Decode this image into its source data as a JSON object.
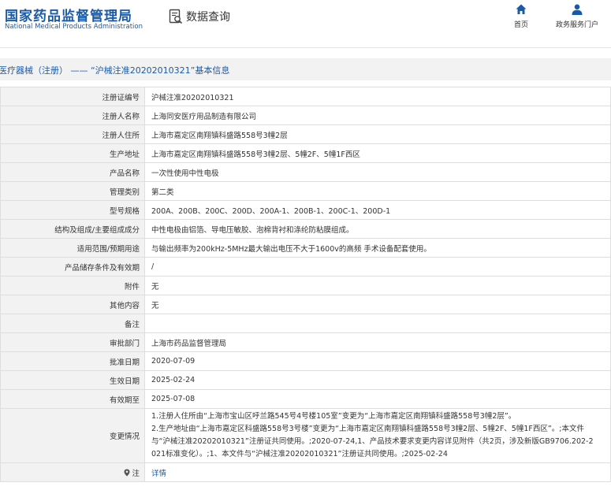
{
  "header": {
    "logo_cn": "国家药品监督管理局",
    "logo_en": "National Medical Products Administration",
    "query_label": "数据查询",
    "nav": [
      {
        "label": "首页",
        "icon": "home-icon"
      },
      {
        "label": "政务服务门户",
        "icon": "user-icon"
      }
    ]
  },
  "title": "医疗器械（注册） —— “沪械注准20202010321”基本信息",
  "rows": [
    {
      "label": "注册证编号",
      "value": "沪械注准20202010321"
    },
    {
      "label": "注册人名称",
      "value": "上海同安医疗用品制造有限公司"
    },
    {
      "label": "注册人住所",
      "value": "上海市嘉定区南翔镇科盛路558号3幢2层"
    },
    {
      "label": "生产地址",
      "value": "上海市嘉定区南翔镇科盛路558号3幢2层、5幢2F、5幢1F西区"
    },
    {
      "label": "产品名称",
      "value": "一次性使用中性电极"
    },
    {
      "label": "管理类别",
      "value": "第二类"
    },
    {
      "label": "型号规格",
      "value": "200A、200B、200C、200D、200A-1、200B-1、200C-1、200D-1"
    },
    {
      "label": "结构及组成/主要组成成分",
      "value": "中性电极由铝箔、导电压敏胶、泡棉背衬和涤纶防粘膜组成。"
    },
    {
      "label": "适用范围/预期用途",
      "value": "与输出频率为200kHz-5MHz最大输出电压不大于1600v的高频 手术设备配套使用。"
    },
    {
      "label": "产品储存条件及有效期",
      "value": "/"
    },
    {
      "label": "附件",
      "value": "无"
    },
    {
      "label": "其他内容",
      "value": "无"
    },
    {
      "label": "备注",
      "value": ""
    },
    {
      "label": "审批部门",
      "value": "上海市药品监督管理局"
    },
    {
      "label": "批准日期",
      "value": "2020-07-09"
    },
    {
      "label": "生效日期",
      "value": "2025-02-24"
    },
    {
      "label": "有效期至",
      "value": "2025-07-08"
    }
  ],
  "changes": {
    "label": "变更情况",
    "lines": [
      "1.注册人住所由“上海市宝山区呼兰路545号4号楼105室”变更为“上海市嘉定区南翔镇科盛路558号3幢2层”。",
      "2.生产地址由“上海市嘉定区科盛路558号3号楼”变更为“上海市嘉定区南翔镇科盛路558号3幢2层、5幢2F、5幢1F西区”。;本文件",
      "与“沪械注准20202010321”注册证共同使用。;2020-07-24,1、产品技术要求变更内容详见附件（共2页，涉及新版GB9706.202-2",
      "021标准变化）。;1、本文件与“沪械注准20202010321”注册证共同使用。;2025-02-24"
    ]
  },
  "note": {
    "label": "注",
    "link": "详情"
  },
  "colors": {
    "brand": "#1a5ba8",
    "label_bg": "#f2f2f2",
    "border": "#dedede"
  }
}
